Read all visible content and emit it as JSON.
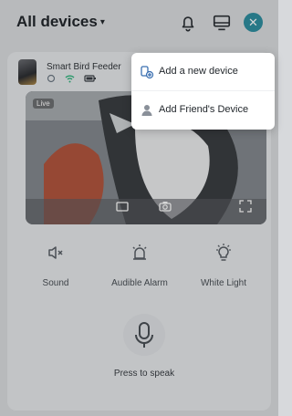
{
  "header": {
    "title": "All devices",
    "caret": "▾"
  },
  "device": {
    "name": "Smart Bird Feeder"
  },
  "video": {
    "live_label": "Live"
  },
  "controls": [
    {
      "label": "Sound"
    },
    {
      "label": "Audible Alarm"
    },
    {
      "label": "White Light"
    }
  ],
  "speak": {
    "label": "Press to speak"
  },
  "menu": {
    "items": [
      {
        "label": "Add a new device",
        "icon": "add-device-icon"
      },
      {
        "label": "Add Friend's Device",
        "icon": "friend-icon"
      }
    ]
  },
  "colors": {
    "accent": "#2f8fa1",
    "wifi": "#2fb47c",
    "background": "#dcdee1",
    "card": "#e8eaec",
    "menu": "#ffffff"
  }
}
